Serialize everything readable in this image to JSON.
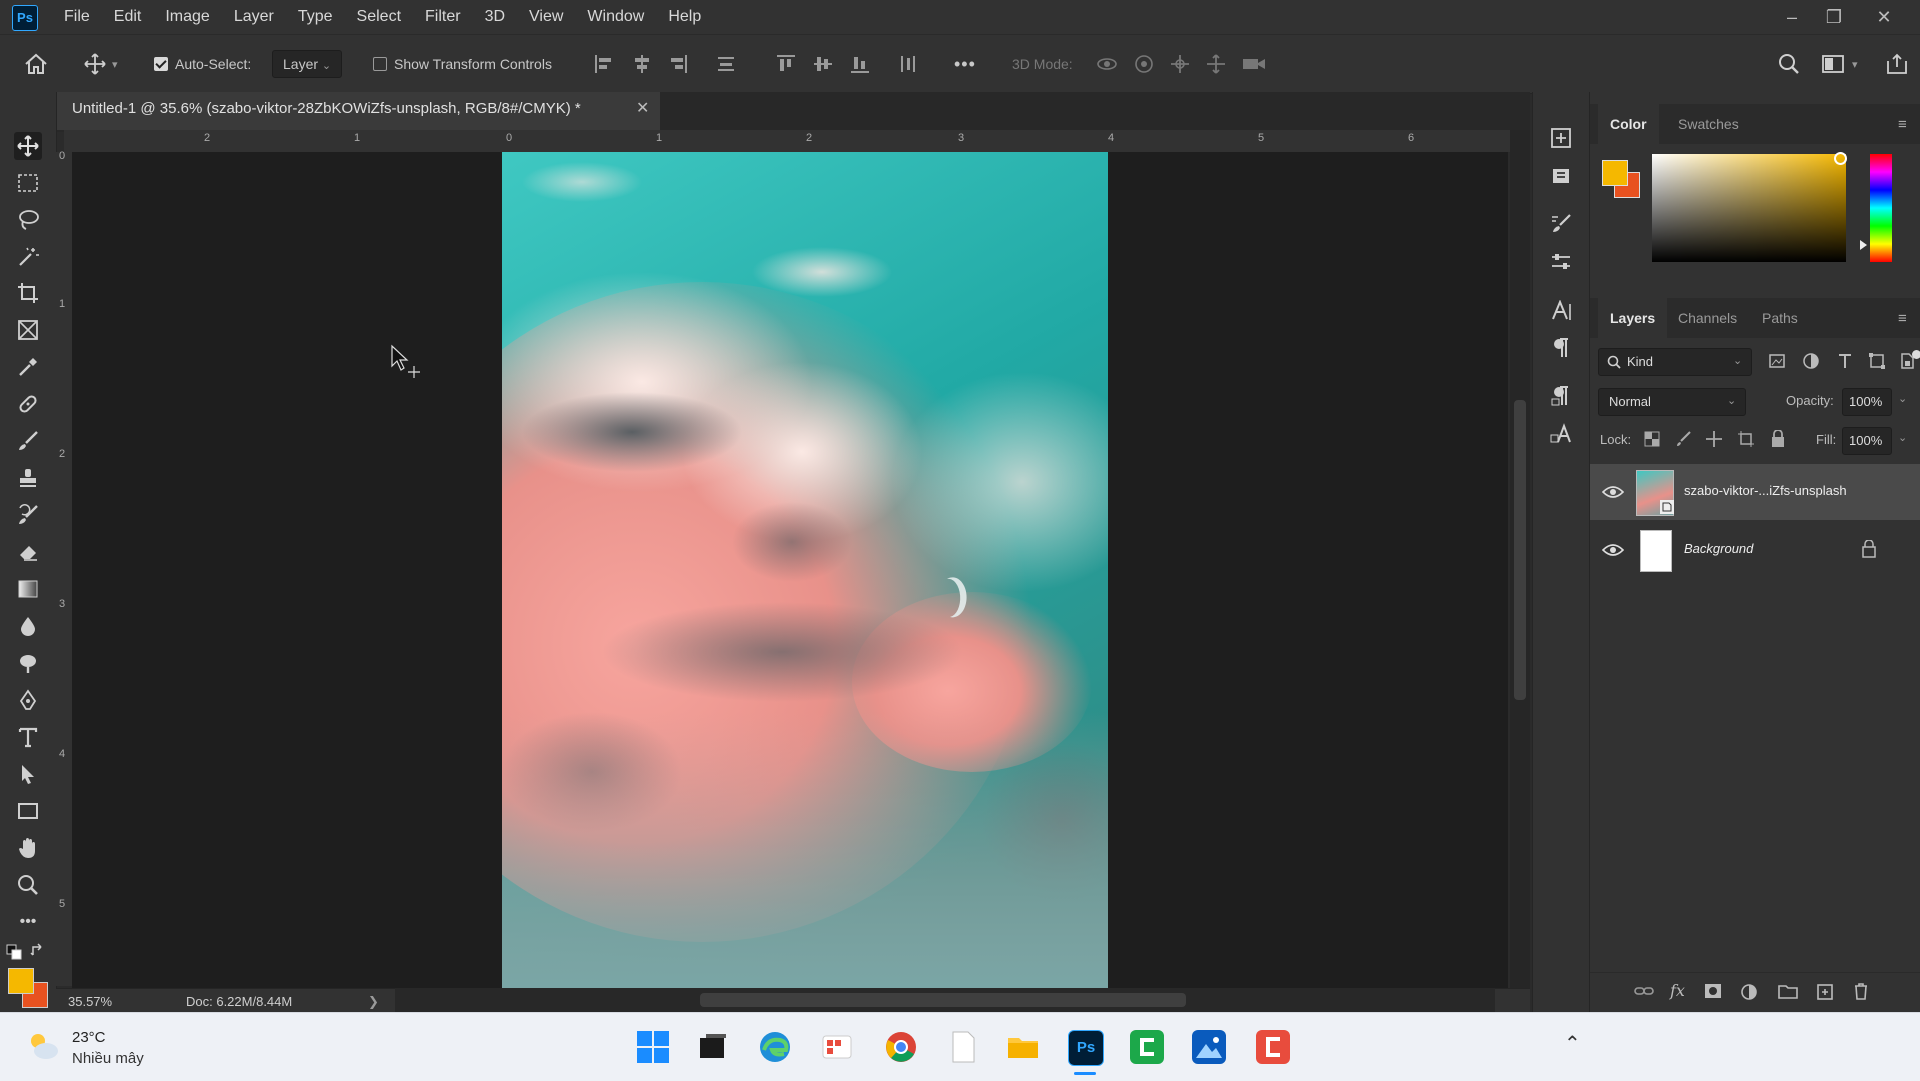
{
  "app": {
    "logo": "Ps"
  },
  "menu": [
    "File",
    "Edit",
    "Image",
    "Layer",
    "Type",
    "Select",
    "Filter",
    "3D",
    "View",
    "Window",
    "Help"
  ],
  "window_controls": {
    "minimize": "–",
    "restore": "❐",
    "close": "✕"
  },
  "options": {
    "auto_select_label": "Auto-Select:",
    "auto_select_checked": true,
    "auto_select_target": "Layer",
    "show_transform_label": "Show Transform Controls",
    "show_transform_checked": false,
    "more": "•••",
    "mode_3d_label": "3D Mode:"
  },
  "document_tab": {
    "title": "Untitled-1 @ 35.6% (szabo-viktor-28ZbKOWiZfs-unsplash, RGB/8#/CMYK) *",
    "close": "✕"
  },
  "ruler_top_labels": [
    "2",
    "1",
    "0",
    "1",
    "2",
    "3",
    "4",
    "5",
    "6"
  ],
  "ruler_left_labels": [
    "0",
    "1",
    "2",
    "3",
    "4",
    "5"
  ],
  "status": {
    "zoom": "35.57%",
    "doc": "Doc: 6.22M/8.44M",
    "arrow": "❯"
  },
  "color_panel": {
    "tabs": [
      "Color",
      "Swatches"
    ],
    "foreground": "#f5b800",
    "background": "#e85220"
  },
  "layers_panel": {
    "tabs": [
      "Layers",
      "Channels",
      "Paths"
    ],
    "filter_kind": "Kind",
    "blend_mode": "Normal",
    "opacity_label": "Opacity:",
    "opacity_value": "100%",
    "lock_label": "Lock:",
    "fill_label": "Fill:",
    "fill_value": "100%",
    "layers": [
      {
        "name": "szabo-viktor-...iZfs-unsplash",
        "visible": true,
        "selected": true
      },
      {
        "name": "Background",
        "visible": true,
        "locked": true
      }
    ]
  },
  "taskbar": {
    "weather_temp": "23°C",
    "weather_desc": "Nhiều mây"
  }
}
